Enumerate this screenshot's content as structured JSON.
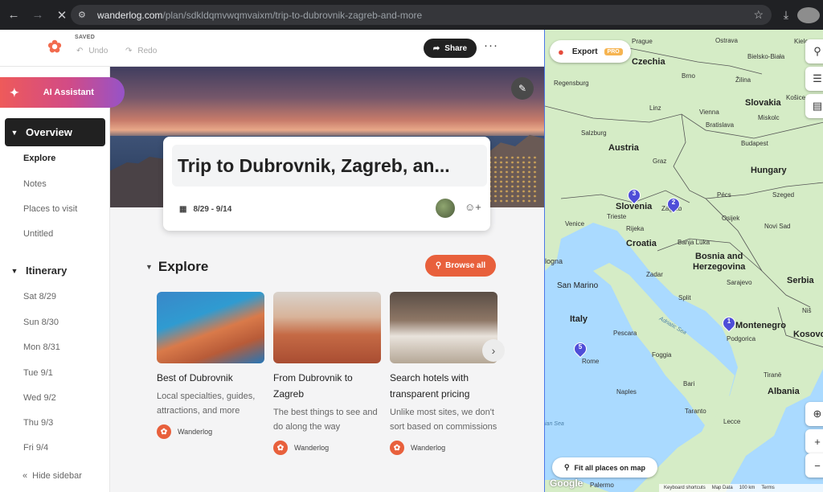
{
  "browser": {
    "url_host": "wanderlog.com",
    "url_path": "/plan/sdkldqmvwqmvaixm/trip-to-dubrovnik-zagreb-and-more"
  },
  "toolbar": {
    "saved_label": "SAVED",
    "undo_label": "Undo",
    "redo_label": "Redo",
    "share_label": "Share",
    "more_label": "···"
  },
  "sidebar": {
    "ai_assistant_label": "AI Assistant",
    "overview_label": "Overview",
    "overview_items": [
      "Explore",
      "Notes",
      "Places to visit",
      "Untitled"
    ],
    "itinerary_label": "Itinerary",
    "itinerary_days": [
      "Sat 8/29",
      "Sun 8/30",
      "Mon 8/31",
      "Tue 9/1",
      "Wed 9/2",
      "Thu 9/3",
      "Fri 9/4"
    ],
    "hide_label": "Hide sidebar"
  },
  "trip": {
    "title": "Trip to Dubrovnik, Zagreb, an...",
    "dates": "8/29 - 9/14"
  },
  "explore": {
    "heading": "Explore",
    "browse_all_label": "Browse all",
    "cards": [
      {
        "title": "Best of Dubrovnik",
        "desc": "Local specialties, guides, attractions, and more",
        "source": "Wanderlog"
      },
      {
        "title": "From Dubrovnik to Zagreb",
        "desc": "The best things to see and do along the way",
        "source": "Wanderlog"
      },
      {
        "title": "Search hotels with transparent pricing",
        "desc": "Unlike most sites, we don't sort based on commissions",
        "source": "Wanderlog"
      }
    ]
  },
  "map": {
    "export_label": "Export",
    "pro_badge": "PRO",
    "fit_label": "Fit all places on map",
    "google_label": "Google",
    "attribution": [
      "Keyboard shortcuts",
      "Map Data",
      "100 km",
      "Terms"
    ],
    "labels": {
      "czechia": "Czechia",
      "austria": "Austria",
      "slovakia": "Slovakia",
      "hungary": "Hungary",
      "slovenia": "Slovenia",
      "croatia": "Croatia",
      "bosnia": "Bosnia and",
      "herzegovina": "Herzegovina",
      "serbia": "Serbia",
      "italy": "Italy",
      "montenegro": "Montenegro",
      "kosovo": "Kosovo",
      "albania": "Albania",
      "sanmarino": "San Marino",
      "rome": "Rome",
      "vienna": "Vienna",
      "bratislava": "Bratislava",
      "budapest": "Budapest",
      "prague": "Prague",
      "brno": "Brno",
      "graz": "Graz",
      "salzburg": "Salzburg",
      "regensburg": "Regensburg",
      "venice": "Venice",
      "trieste": "Trieste",
      "rijeka": "Rijeka",
      "zadar": "Zadar",
      "split": "Split",
      "sarajevo": "Sarajevo",
      "podgorica": "Podgorica",
      "naples": "Naples",
      "bari": "Bari",
      "palermo": "Palermo",
      "tirane": "Tiranë",
      "szeged": "Szeged",
      "novisad": "Novi Sad",
      "osijek": "Osijek",
      "pecs": "Pécs",
      "linz": "Linz",
      "adriatic": "Adriatic Sea",
      "tyrrhenian": "ian Sea",
      "bologna": "logna",
      "pescara": "Pescara",
      "foggia": "Foggia",
      "lecce": "Lecce",
      "taranto": "Taranto",
      "zilina": "Žilina",
      "kosice": "Košice",
      "miskolc": "Miskolc",
      "ostrava": "Ostrava",
      "nis": "Niš",
      "banja": "Banja Luka",
      "zagreb": "Zagreb",
      "bielsko": "Bielsko-Biała",
      "kielce": "Kielce"
    },
    "pins": [
      "1",
      "2",
      "3",
      "5"
    ]
  },
  "colors": {
    "brand": "#e8603c",
    "pin": "#4f4ed8",
    "dark_button": "#212121"
  }
}
